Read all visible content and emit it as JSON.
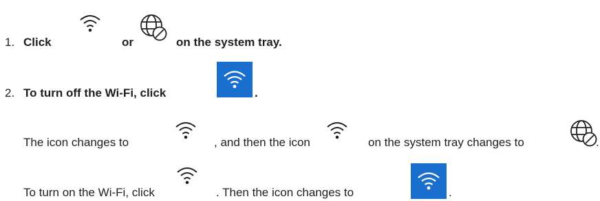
{
  "step1": {
    "number": "1.",
    "click": "Click",
    "or": "or",
    "rest": "on the system tray."
  },
  "step2": {
    "number": "2.",
    "text": "To turn off the Wi-Fi, click",
    "period": "."
  },
  "para1": {
    "part1": "The icon changes to",
    "part2": ", and then the icon",
    "part3": "on the system tray changes to",
    "period": "."
  },
  "para2": {
    "part1": "To turn on the Wi-Fi, click",
    "part2": ". Then the icon changes to",
    "period": "."
  },
  "icons": {
    "wifi": "wifi-icon",
    "wifi_highlighted": "wifi-on-icon",
    "globe_disabled": "globe-no-connection-icon",
    "highlight_color": "#1a6fce"
  }
}
